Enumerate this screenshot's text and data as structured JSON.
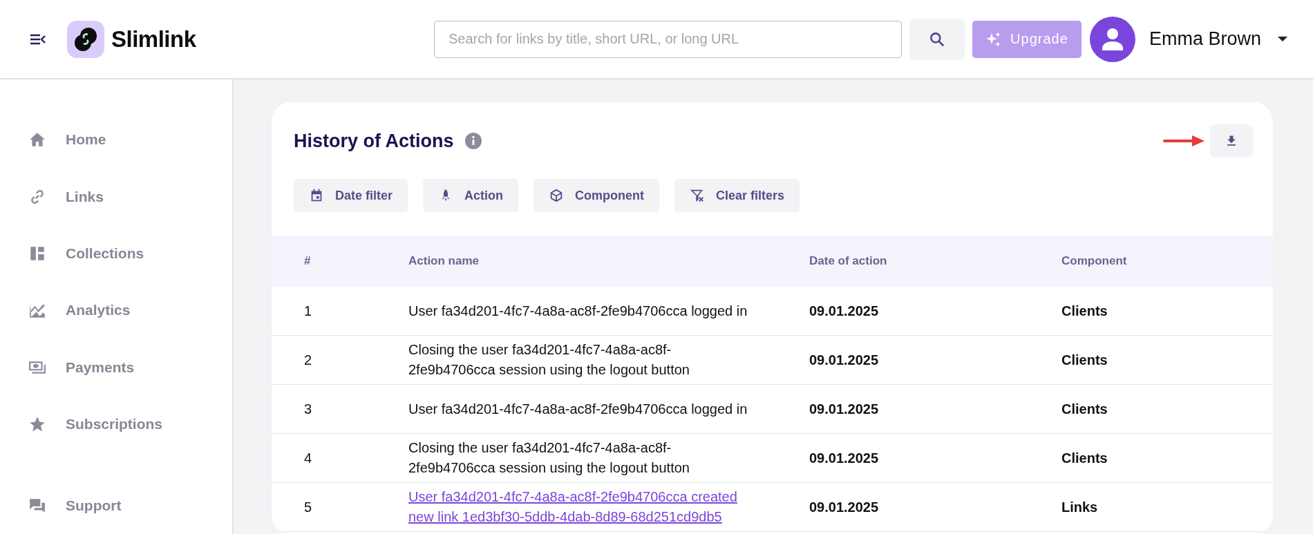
{
  "header": {
    "brand": "Slimlink",
    "search": {
      "placeholder": "Search for links by title, short URL, or long URL"
    },
    "upgrade_button": "Upgrade",
    "user": {
      "name": "Emma Brown"
    }
  },
  "sidebar": {
    "items": [
      {
        "label": "Home"
      },
      {
        "label": "Links"
      },
      {
        "label": "Collections"
      },
      {
        "label": "Analytics"
      },
      {
        "label": "Payments"
      },
      {
        "label": "Subscriptions"
      },
      {
        "label": "Support"
      }
    ]
  },
  "history": {
    "title": "History of Actions",
    "filters": [
      {
        "label": "Date filter"
      },
      {
        "label": "Action"
      },
      {
        "label": "Component"
      },
      {
        "label": "Clear filters"
      }
    ],
    "table": {
      "columns": [
        "#",
        "Action name",
        "Date of action",
        "Component"
      ],
      "rows": [
        {
          "number": "1",
          "action": "User fa34d201-4fc7-4a8a-ac8f-2fe9b4706cca logged in",
          "kind": "text",
          "date": "09.01.2025",
          "component": "Clients"
        },
        {
          "number": "2",
          "action": "Closing the user fa34d201-4fc7-4a8a-ac8f-2fe9b4706cca session using the logout button",
          "kind": "text",
          "date": "09.01.2025",
          "component": "Clients"
        },
        {
          "number": "3",
          "action": "User fa34d201-4fc7-4a8a-ac8f-2fe9b4706cca logged in",
          "kind": "text",
          "date": "09.01.2025",
          "component": "Clients"
        },
        {
          "number": "4",
          "action": "Closing the user fa34d201-4fc7-4a8a-ac8f-2fe9b4706cca session using the logout button",
          "kind": "text",
          "date": "09.01.2025",
          "component": "Clients"
        },
        {
          "number": "5",
          "action": "User fa34d201-4fc7-4a8a-ac8f-2fe9b4706cca created new link 1ed3bf30-5ddb-4dab-8d89-68d251cd9db5",
          "kind": "link",
          "date": "09.01.2025",
          "component": "Links"
        }
      ]
    }
  }
}
